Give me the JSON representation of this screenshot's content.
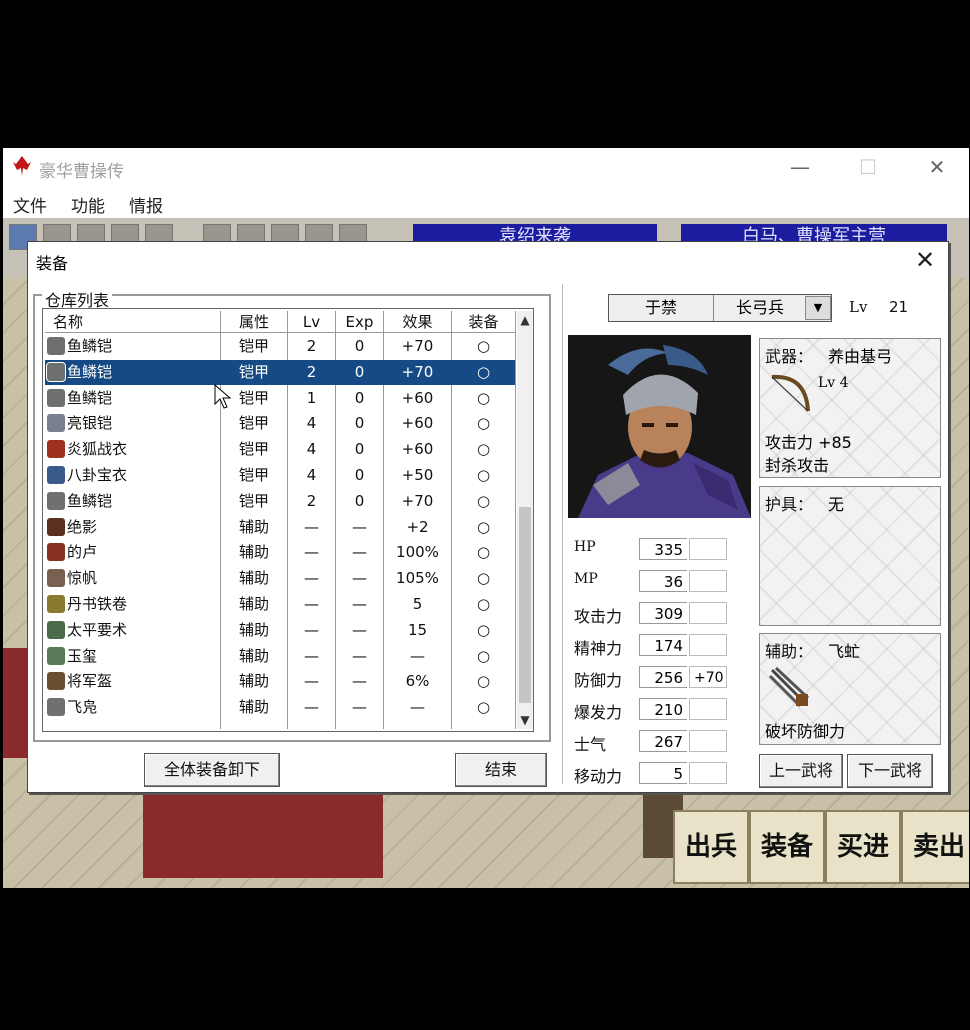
{
  "window": {
    "title": "豪华曹操传",
    "minimize": "—",
    "maximize": "☐",
    "close": "✕"
  },
  "menu": [
    "文件",
    "功能",
    "情报"
  ],
  "banners": [
    "袁绍来袭",
    "白马、曹操军主营"
  ],
  "dialog": {
    "title": "装备",
    "close": "✕",
    "warehouse_label": "仓库列表",
    "columns": [
      "名称",
      "属性",
      "Lv",
      "Exp",
      "效果",
      "装备"
    ],
    "items": [
      {
        "name": "鱼鳞铠",
        "attr": "铠甲",
        "lv": "2",
        "exp": "0",
        "effect": "+70",
        "equip": "○",
        "icon_color": "#6f6f6f"
      },
      {
        "name": "鱼鳞铠",
        "attr": "铠甲",
        "lv": "2",
        "exp": "0",
        "effect": "+70",
        "equip": "○",
        "icon_color": "#6f6f6f"
      },
      {
        "name": "鱼鳞铠",
        "attr": "铠甲",
        "lv": "1",
        "exp": "0",
        "effect": "+60",
        "equip": "○",
        "icon_color": "#6f6f6f"
      },
      {
        "name": "亮银铠",
        "attr": "铠甲",
        "lv": "4",
        "exp": "0",
        "effect": "+60",
        "equip": "○",
        "icon_color": "#7a8090"
      },
      {
        "name": "炎狐战衣",
        "attr": "铠甲",
        "lv": "4",
        "exp": "0",
        "effect": "+60",
        "equip": "○",
        "icon_color": "#a03020"
      },
      {
        "name": "八卦宝衣",
        "attr": "铠甲",
        "lv": "4",
        "exp": "0",
        "effect": "+50",
        "equip": "○",
        "icon_color": "#3a5a8a"
      },
      {
        "name": "鱼鳞铠",
        "attr": "铠甲",
        "lv": "2",
        "exp": "0",
        "effect": "+70",
        "equip": "○",
        "icon_color": "#6f6f6f"
      },
      {
        "name": "绝影",
        "attr": "辅助",
        "lv": "—",
        "exp": "—",
        "effect": "+2",
        "equip": "○",
        "icon_color": "#5a3020"
      },
      {
        "name": "的卢",
        "attr": "辅助",
        "lv": "—",
        "exp": "—",
        "effect": "100%",
        "equip": "○",
        "icon_color": "#8a3020"
      },
      {
        "name": "惊帆",
        "attr": "辅助",
        "lv": "—",
        "exp": "—",
        "effect": "105%",
        "equip": "○",
        "icon_color": "#7a6050"
      },
      {
        "name": "丹书铁卷",
        "attr": "辅助",
        "lv": "—",
        "exp": "—",
        "effect": "5",
        "equip": "○",
        "icon_color": "#8a7a30"
      },
      {
        "name": "太平要术",
        "attr": "辅助",
        "lv": "—",
        "exp": "—",
        "effect": "15",
        "equip": "○",
        "icon_color": "#4a6a4a"
      },
      {
        "name": "玉玺",
        "attr": "辅助",
        "lv": "—",
        "exp": "—",
        "effect": "—",
        "equip": "○",
        "icon_color": "#5a7a5a"
      },
      {
        "name": "将军盔",
        "attr": "辅助",
        "lv": "—",
        "exp": "—",
        "effect": "6%",
        "equip": "○",
        "icon_color": "#6a5030"
      },
      {
        "name": "飞凫",
        "attr": "辅助",
        "lv": "—",
        "exp": "—",
        "effect": "—",
        "equip": "○",
        "icon_color": "#707070"
      }
    ],
    "selected_index": 1,
    "btn_unequip_all": "全体装备卸下",
    "btn_end": "结束",
    "character": {
      "name": "于禁",
      "class": "长弓兵",
      "lv_label": "Lv",
      "lv": "21",
      "stats": [
        {
          "label": "HP",
          "value": "335",
          "bonus": ""
        },
        {
          "label": "MP",
          "value": "36",
          "bonus": ""
        },
        {
          "label": "攻击力",
          "value": "309",
          "bonus": ""
        },
        {
          "label": "精神力",
          "value": "174",
          "bonus": ""
        },
        {
          "label": "防御力",
          "value": "256",
          "bonus": "+70"
        },
        {
          "label": "爆发力",
          "value": "210",
          "bonus": ""
        },
        {
          "label": "士气",
          "value": "267",
          "bonus": ""
        },
        {
          "label": "移动力",
          "value": "5",
          "bonus": ""
        }
      ]
    },
    "weapon": {
      "label": "武器：",
      "name": "养由基弓",
      "lv": "Lv  4",
      "attack": "攻击力 +85",
      "effect": "封杀攻击"
    },
    "armor": {
      "label": "护具：",
      "name": "无"
    },
    "assist": {
      "label": "辅助：",
      "name": "飞虻",
      "effect": "破坏防御力"
    },
    "btn_prev": "上一武将",
    "btn_next": "下一武将"
  },
  "actions": [
    "出兵",
    "装备",
    "买进",
    "卖出"
  ]
}
